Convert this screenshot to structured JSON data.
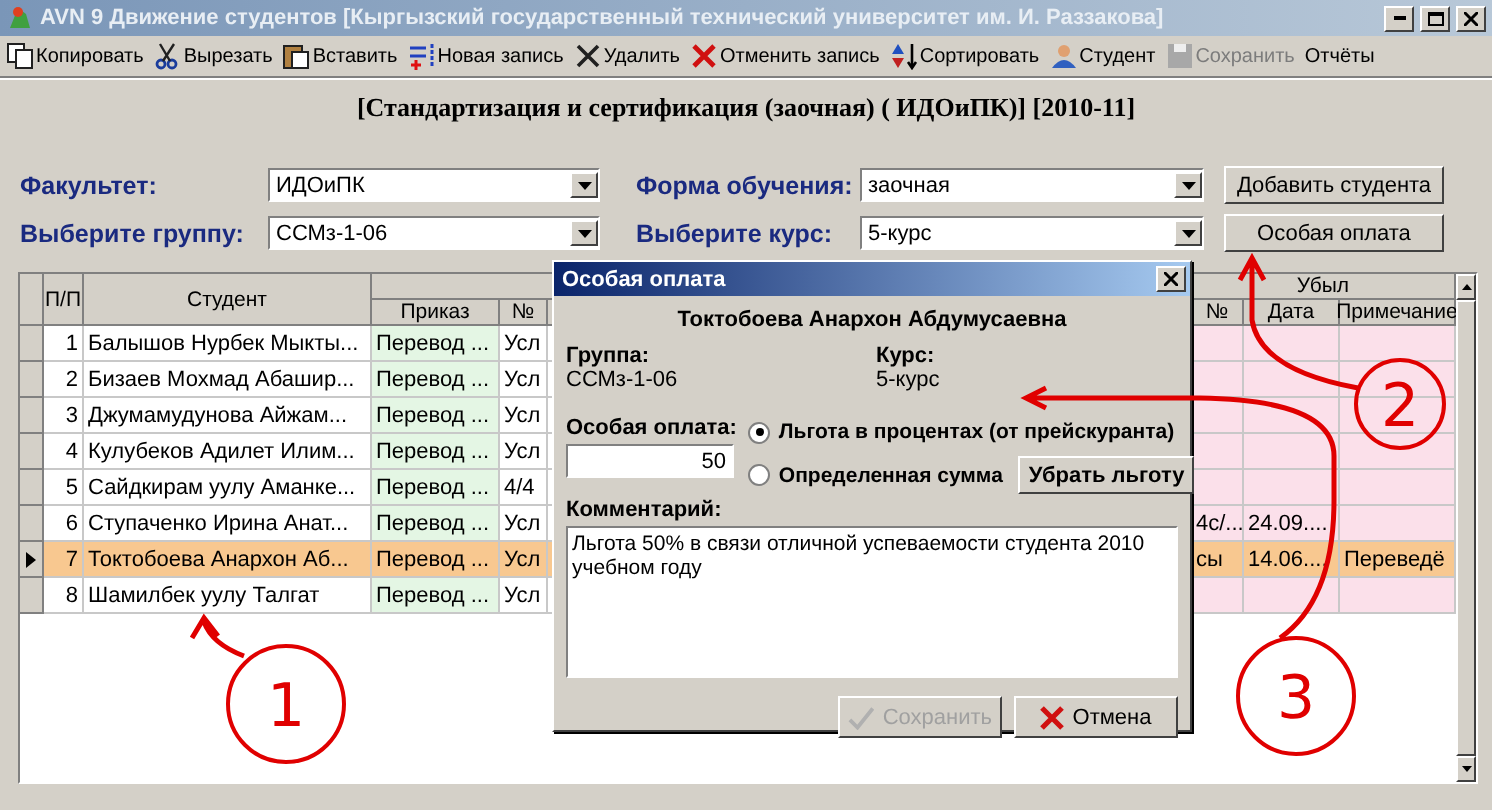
{
  "window": {
    "title": "AVN 9 Движение студентов [Кыргызский государственный технический университет им. И. Раззакова]"
  },
  "toolbar": [
    {
      "label": "Копировать",
      "disabled": false
    },
    {
      "label": "Вырезать",
      "disabled": false
    },
    {
      "label": "Вставить",
      "disabled": false
    },
    {
      "label": "Новая запись",
      "disabled": false
    },
    {
      "label": "Удалить",
      "disabled": false
    },
    {
      "label": "Отменить запись",
      "disabled": false
    },
    {
      "label": "Сортировать",
      "disabled": false
    },
    {
      "label": "Студент",
      "disabled": false
    },
    {
      "label": "Сохранить",
      "disabled": true
    },
    {
      "label": "Отчёты",
      "disabled": false
    }
  ],
  "heading": "[Стандартизация и сертификация  (заочная) ( ИДОиПК)] [2010-11]",
  "filters": [
    {
      "label": "Факультет:",
      "value": "ИДОиПК"
    },
    {
      "label": "Форма обучения:",
      "value": "заочная"
    },
    {
      "label": "Выберите группу:",
      "value": "ССМз-1-06"
    },
    {
      "label": "Выберите курс:",
      "value": "5-курс"
    }
  ],
  "buttons": [
    "Добавить студента",
    "Особая оплата"
  ],
  "table": {
    "columns": {
      "number": "П/П",
      "student": "Студент",
      "order": "Приказ",
      "order_no": "№",
      "dropout": "Убыл",
      "dropout_no": "№",
      "dropout_date": "Дата",
      "note": "Примечание"
    },
    "rows": [
      {
        "number": "1",
        "student": "Балышов Нурбек Мыкты...",
        "order": "Перевод ...",
        "order_no": "Усл",
        "selected": false
      },
      {
        "number": "2",
        "student": "Бизаев Мохмад Абашир...",
        "order": "Перевод ...",
        "order_no": "Усл",
        "selected": false
      },
      {
        "number": "3",
        "student": "Джумамудунова Айжам...",
        "order": "Перевод ...",
        "order_no": "Усл",
        "selected": false
      },
      {
        "number": "4",
        "student": "Кулубеков Адилет Илим...",
        "order": "Перевод ...",
        "order_no": "Усл",
        "selected": false
      },
      {
        "number": "5",
        "student": "Сайдкирам уулу Аманке...",
        "order": "Перевод ...",
        "order_no": "4/4",
        "selected": false
      },
      {
        "number": "6",
        "student": "Ступаченко Ирина Анат...",
        "order": "Перевод ...",
        "order_no": "Усл",
        "dropout_no": "4с/...",
        "dropout_date": "24.09....",
        "selected": false
      },
      {
        "number": "7",
        "student": "Токтобоева Анархон Аб...",
        "order": "Перевод ...",
        "order_no": "Усл",
        "dropout_no": "сы",
        "dropout_date": "14.06....",
        "note": "Переведё",
        "selected": true
      },
      {
        "number": "8",
        "student": "Шамилбек уулу Талгат",
        "order": "Перевод ...",
        "order_no": "Усл",
        "selected": false
      }
    ]
  },
  "dialog": {
    "title": "Особая оплата",
    "student": "Токтобоева Анархон Абдумусаевна",
    "group_label": "Группа:",
    "group": "ССМз-1-06",
    "course_label": "Курс:",
    "course": "5-курс",
    "payment_label": "Особая оплата:",
    "payment": "50",
    "options": [
      {
        "label": "Льгота в процентах (от прейскуранта)",
        "selected": true
      },
      {
        "label": "Определенная сумма",
        "selected": false
      }
    ],
    "remove_button": "Убрать льготу",
    "comment_label": "Комментарий:",
    "comment": "Льгота 50% в связи отличной успеваемости студента 2010 учебном году",
    "buttons": [
      {
        "label": "Сохранить",
        "disabled": true
      },
      {
        "label": "Отмена",
        "disabled": false
      }
    ]
  },
  "annotations": [
    {
      "label": "1"
    },
    {
      "label": "2"
    },
    {
      "label": "3"
    }
  ]
}
